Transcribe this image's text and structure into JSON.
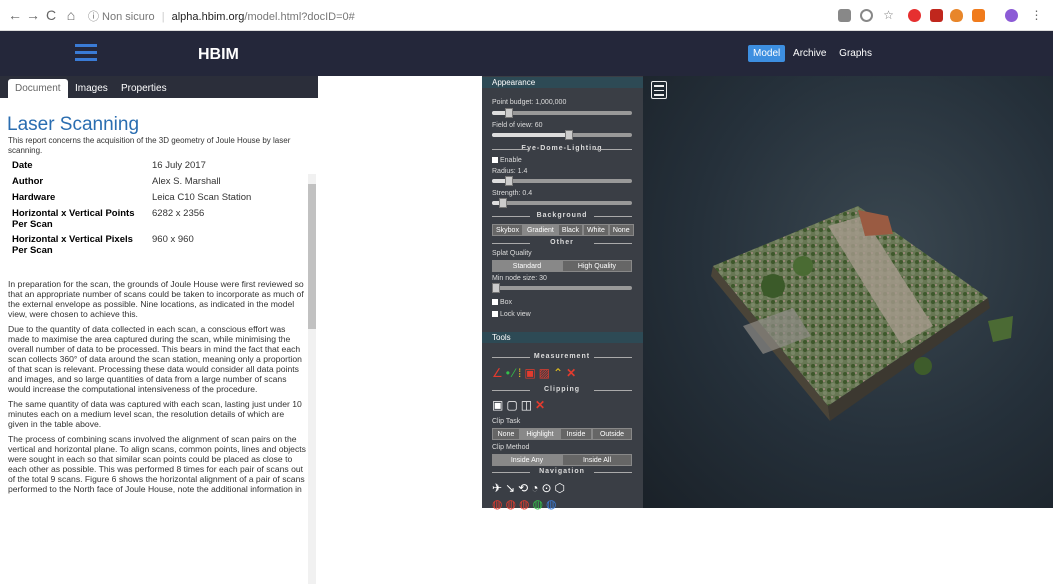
{
  "browser": {
    "back": "←",
    "forward": "→",
    "reload": "C",
    "home": "⌂",
    "security": "ⓘ Non sicuro",
    "domain": "alpha.hbim.org",
    "path": "/model.html?docID=0#"
  },
  "header": {
    "brand": "HBIM",
    "nav": [
      "Model",
      "Archive",
      "Graphs"
    ]
  },
  "left": {
    "tabs": [
      "Document",
      "Images",
      "Properties"
    ],
    "title": "Laser Scanning",
    "subtitle": "This report concerns the acquisition of the 3D geometry of Joule House by laser scanning.",
    "meta": [
      {
        "key": "Date",
        "value": "16 July 2017"
      },
      {
        "key": "Author",
        "value": "Alex S. Marshall"
      },
      {
        "key": "Hardware",
        "value": "Leica C10 Scan Station"
      },
      {
        "key": "Horizontal x Vertical Points Per Scan",
        "value": "6282 x 2356"
      },
      {
        "key": "Horizontal x Vertical Pixels Per Scan",
        "value": "960 x 960"
      }
    ],
    "paragraphs": [
      "In preparation for the scan, the grounds of Joule House were first reviewed so that an appropriate number of scans could be taken to incorporate as much of the external envelope as possible. Nine locations, as indicated in the model view, were chosen to achieve this.",
      "Due to the quantity of data collected in each scan, a conscious effort was made to maximise the area captured during the scan, while minimising the overall number of data to be processed. This bears in mind the fact that each scan collects 360° of data around the scan station, meaning only a proportion of that scan is relevant. Processing these data would consider all data points and images, and so large quantities of data from a large number of scans would increase the computational intensiveness of the procedure.",
      "The same quantity of data was captured with each scan, lasting just under 10 minutes each on a medium level scan, the resolution details of which are given in the table above.",
      "The process of combining scans involved the alignment of scan pairs on the vertical and horizontal plane. To align scans, common points, lines and objects were sought in each so that similar scan points could be placed as close to each other as possible. This was performed 8 times for each pair of scans out of the total 9 scans. Figure 6 shows the horizontal alignment of a pair of scans performed to the North face of Joule House, note the additional information in"
    ]
  },
  "panel": {
    "appearance": "Appearance",
    "point_budget": "Point budget: 1,000,000",
    "point_budget_level": 0.12,
    "fov": "Field of view: 60",
    "fov_level": 0.55,
    "edl": "Eye-Dome-Lighting",
    "enable": "Enable",
    "radius": "Radius: 1.4",
    "radius_level": 0.12,
    "strength": "Strength: 0.4",
    "strength_level": 0.08,
    "background": "Background",
    "bg_buttons": [
      "Skybox",
      "Gradient",
      "Black",
      "White",
      "None"
    ],
    "other": "Other",
    "splat": "Splat Quality",
    "splat_buttons": [
      "Standard",
      "High Quality"
    ],
    "min_node": "Min node size: 30",
    "min_node_level": 0.03,
    "box": "Box",
    "lock": "Lock view",
    "tools": "Tools",
    "measurement": "Measurement",
    "clipping": "Clipping",
    "clip_task": "Clip Task",
    "clip_task_buttons": [
      "None",
      "Highlight",
      "Inside",
      "Outside"
    ],
    "clip_method": "Clip Method",
    "clip_method_buttons": [
      "Inside Any",
      "Inside All"
    ],
    "navigation": "Navigation"
  },
  "icons": {
    "menu": "menu-icon",
    "measure_tools": [
      "angle-icon",
      "point-icon",
      "distance-icon",
      "height-icon",
      "area-icon",
      "volume-icon",
      "profile-icon",
      "remove-icon"
    ],
    "clip_tools": [
      "clip-volume-icon",
      "clip-polygon-icon",
      "clip-plane-icon",
      "remove-icon"
    ],
    "nav_tools": [
      "fly-icon",
      "earth-icon",
      "orbit-icon",
      "helicopter-icon",
      "focus-icon",
      "cube-icon"
    ]
  },
  "colors": {
    "header": "#24273a",
    "accent": "#3d8fe0",
    "panel": "#3a3e45",
    "section": "#2d4a55",
    "title": "#2a6db0"
  }
}
